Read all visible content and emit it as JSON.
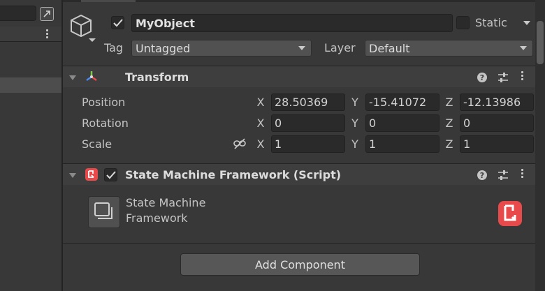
{
  "header": {
    "object_name": "MyObject",
    "active_checked": true,
    "static_label": "Static",
    "static_checked": false,
    "tag_label": "Tag",
    "tag_value": "Untagged",
    "layer_label": "Layer",
    "layer_value": "Default",
    "icon": "cube-icon"
  },
  "transform": {
    "title": "Transform",
    "rows": [
      {
        "label": "Position",
        "x": "28.50369",
        "y": "-15.41072",
        "z": "-12.13986"
      },
      {
        "label": "Rotation",
        "x": "0",
        "y": "0",
        "z": "0"
      },
      {
        "label": "Scale",
        "x": "1",
        "y": "1",
        "z": "1"
      }
    ],
    "axes": {
      "x": "X",
      "y": "Y",
      "z": "Z"
    }
  },
  "script_component": {
    "title": "State Machine Framework (Script)",
    "enabled": true,
    "name_line1": "State Machine",
    "name_line2": "Framework",
    "accent_color": "#e8494b"
  },
  "add_component_label": "Add Component",
  "colors": {
    "background": "#383838",
    "field": "#2a2a2a",
    "accent": "#e8494b"
  }
}
